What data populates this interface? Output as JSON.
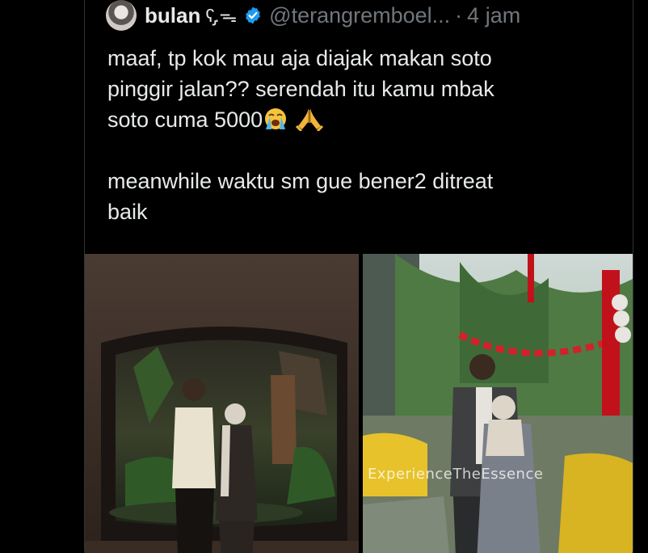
{
  "tweet": {
    "author_name": "bulan",
    "name_decoration": "ʕ̡.ᯓ",
    "handle": "@terangremboel...",
    "separator": "·",
    "time": "4 jam",
    "verified": true,
    "lines": [
      "maaf, tp kok mau aja diajak makan soto",
      "pinggir jalan?? serendah itu kamu mbak",
      "soto cuma 5000",
      "meanwhile waktu sm gue bener2 ditreat",
      "baik"
    ],
    "emoji_1": "crying-face",
    "emoji_2": "folded-hands"
  },
  "media": {
    "left_photo": "couple-in-front-of-aquarium",
    "right_photo": "couple-in-garden-with-lanterns",
    "watermark": "ExperienceTheEssence"
  },
  "colors": {
    "background": "#000000",
    "text": "#e7e9ea",
    "muted": "#71767b",
    "border": "#2f3336",
    "verified_blue": "#1d9bf0"
  }
}
